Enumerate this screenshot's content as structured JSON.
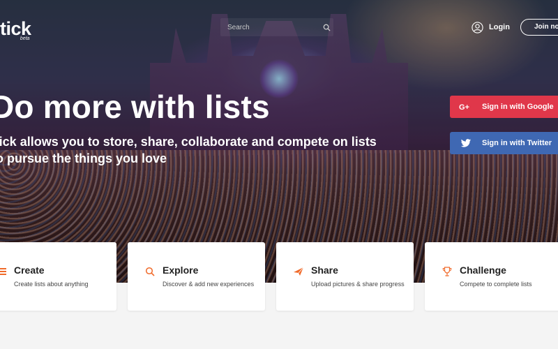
{
  "header": {
    "logo_text": "tick",
    "logo_badge": "beta",
    "search_placeholder": "Search",
    "login_label": "Login",
    "join_label": "Join now"
  },
  "hero": {
    "headline": "Do more with lists",
    "subline_1": "Tick allows you to store, share, collaborate and compete on lists",
    "subline_2": "to pursue the things you love"
  },
  "auth": {
    "google_label": "Sign in with Google",
    "twitter_label": "Sign in with Twitter"
  },
  "features": [
    {
      "title": "Create",
      "desc": "Create lists about anything",
      "icon": "list-icon"
    },
    {
      "title": "Explore",
      "desc": "Discover & add new experiences",
      "icon": "search-icon"
    },
    {
      "title": "Share",
      "desc": "Upload pictures & share progress",
      "icon": "paper-plane-icon"
    },
    {
      "title": "Challenge",
      "desc": "Compete to complete lists",
      "icon": "trophy-icon"
    }
  ],
  "colors": {
    "google_red": "#e0374a",
    "twitter_blue": "#3f68b3",
    "accent_orange": "#f06a2a"
  }
}
